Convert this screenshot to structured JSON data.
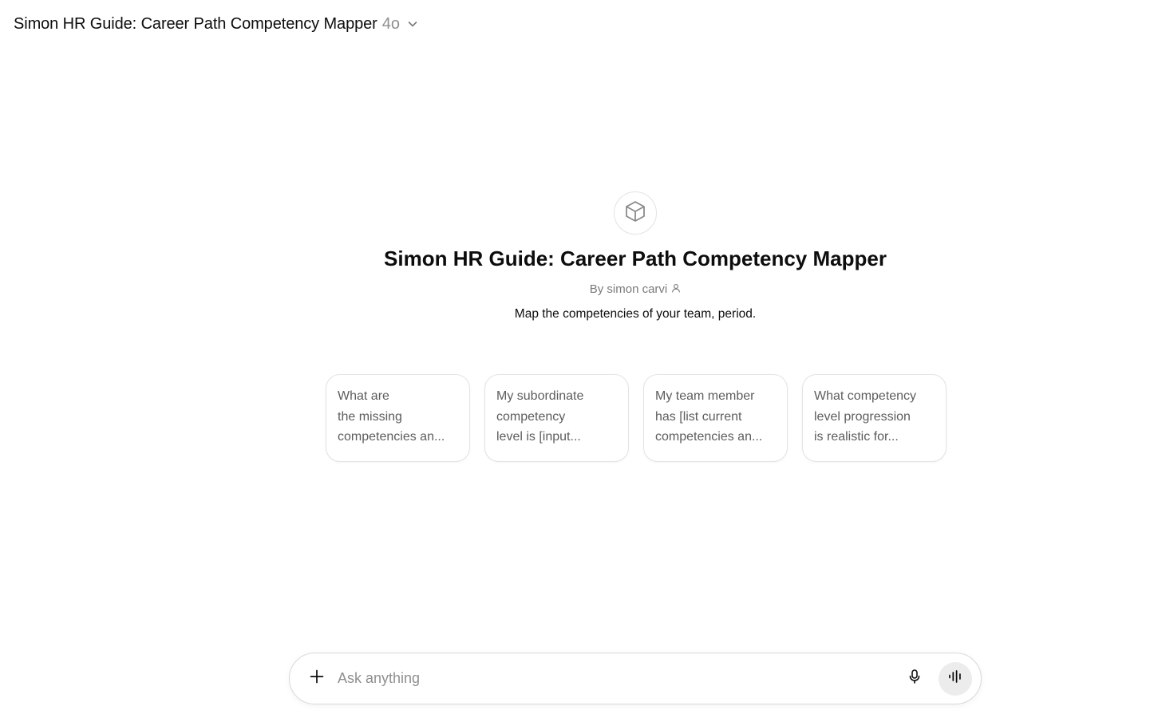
{
  "header": {
    "title": "Simon HR Guide: Career Path Competency Mapper",
    "model": "4o"
  },
  "gpt": {
    "icon": "cube-icon",
    "title": "Simon HR Guide: Career Path Competency Mapper",
    "author": "By simon carvi",
    "description": "Map the competencies of your team, period."
  },
  "starters": [
    {
      "lines": [
        "What are",
        "the missing",
        "competencies an..."
      ]
    },
    {
      "lines": [
        "My subordinate",
        "competency",
        "level is [input..."
      ]
    },
    {
      "lines": [
        "My team member",
        "has [list current",
        "competencies an..."
      ]
    },
    {
      "lines": [
        "What competency",
        "level progression",
        "is realistic for..."
      ]
    }
  ],
  "composer": {
    "placeholder": "Ask anything"
  },
  "icons": {
    "plus": "plus-icon",
    "mic": "microphone-icon",
    "voice": "voice-mode-icon",
    "user": "user-icon",
    "chevron": "chevron-down-icon"
  }
}
